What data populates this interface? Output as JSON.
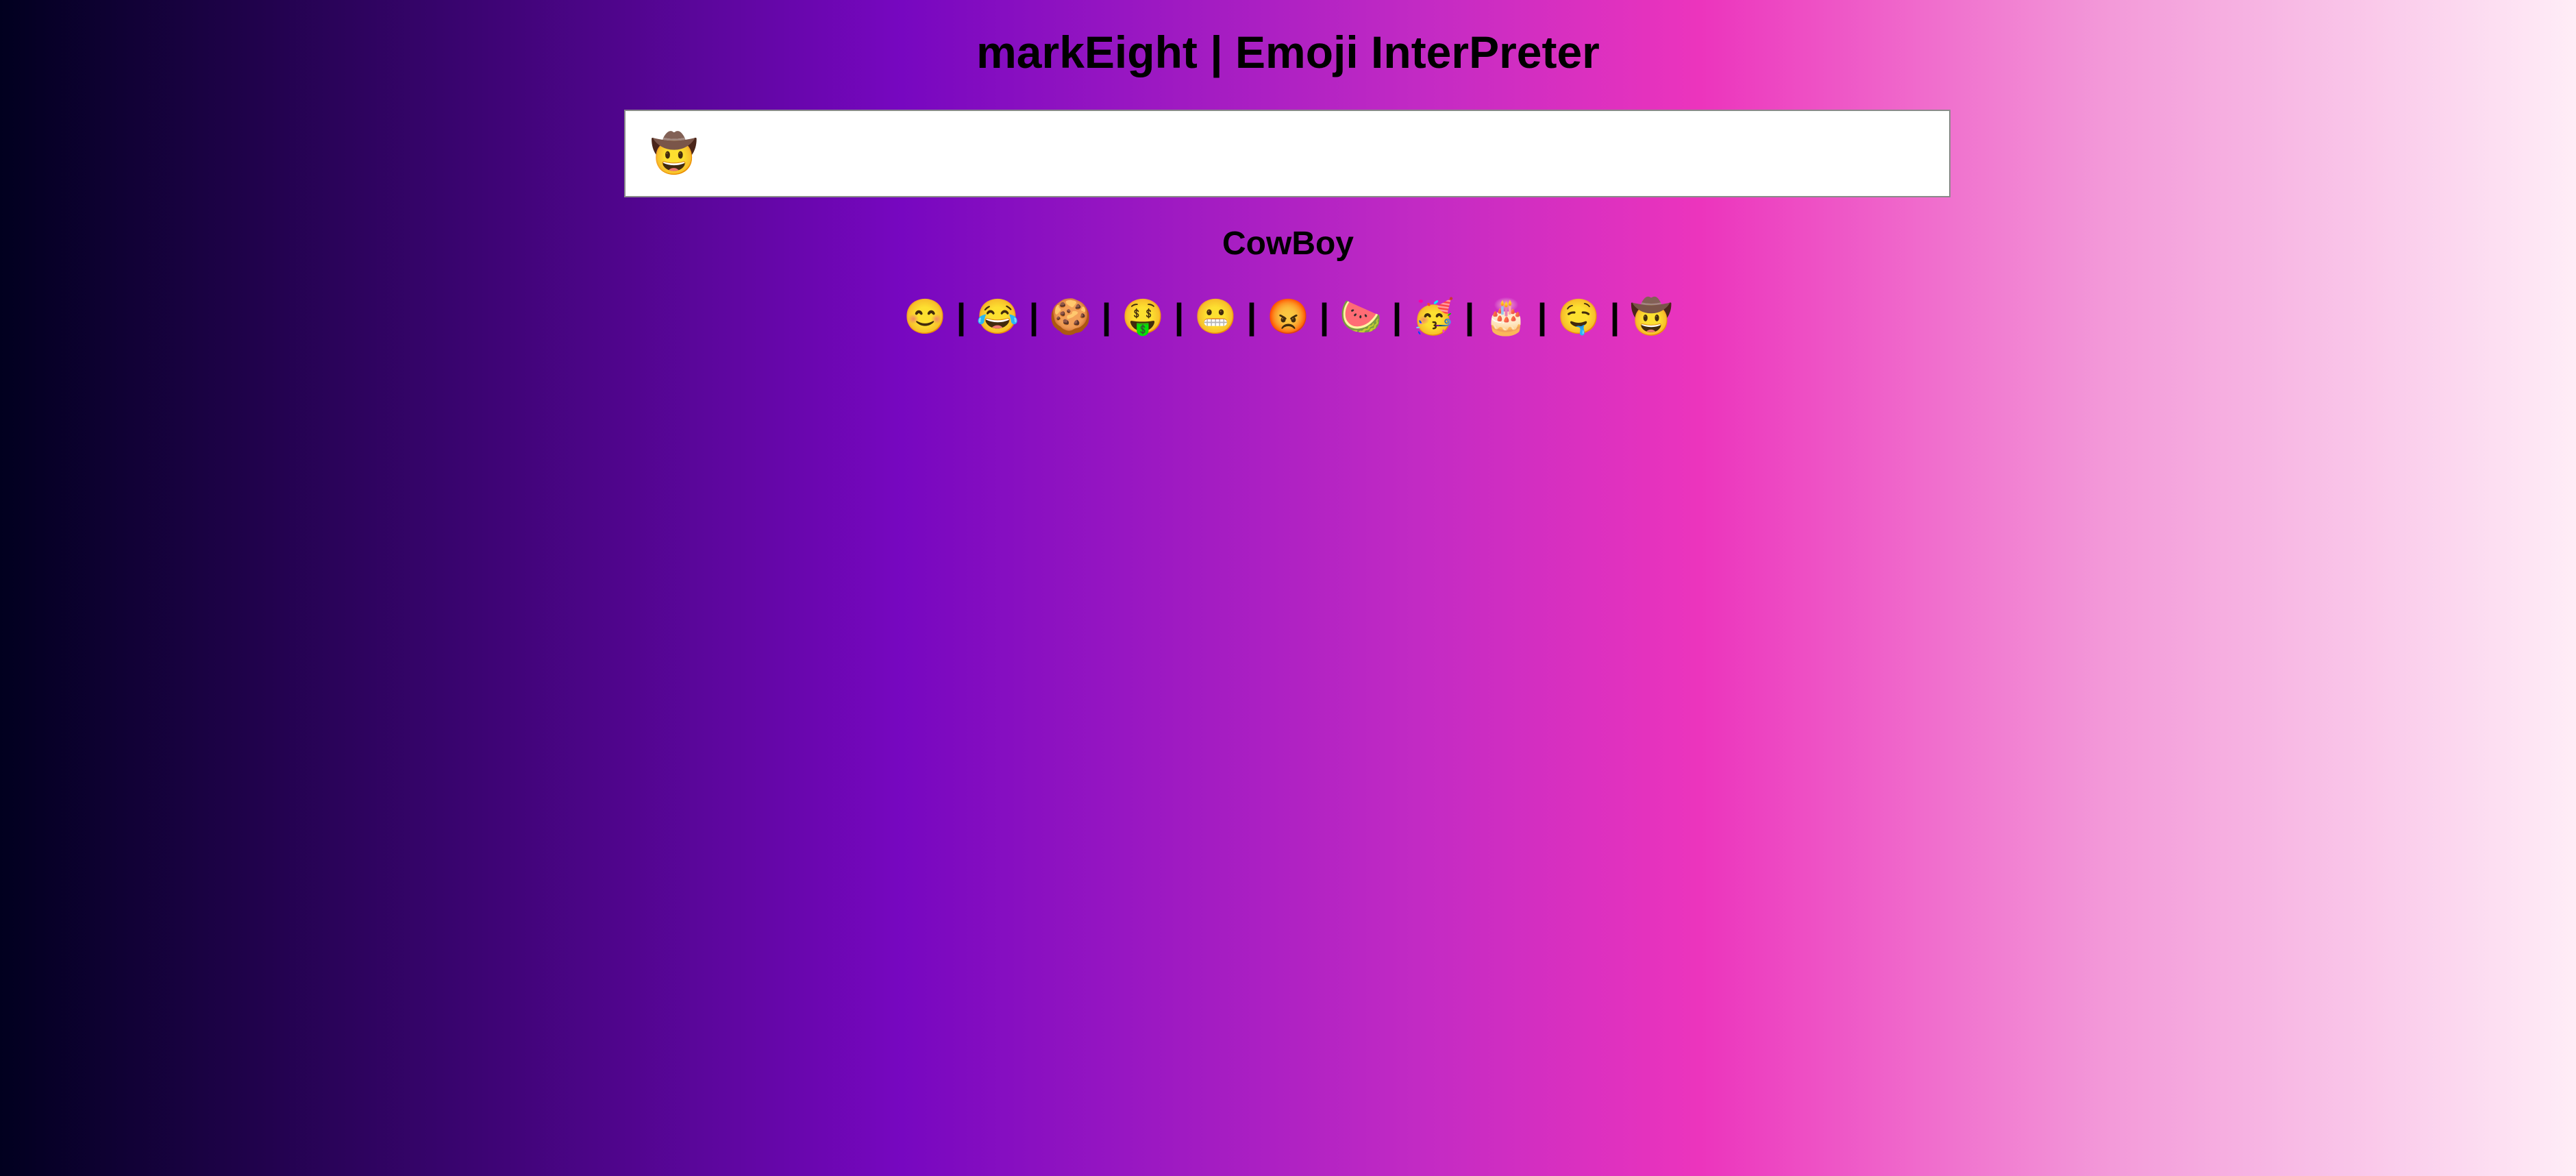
{
  "header": {
    "title": "markEight | Emoji InterPreter"
  },
  "search": {
    "value": "🤠",
    "placeholder": ""
  },
  "output": {
    "meaning": "CowBoy"
  },
  "emoji_list": {
    "separator": "|",
    "items": [
      {
        "emoji": "😊",
        "icon": "smiling-face-icon"
      },
      {
        "emoji": "😂",
        "icon": "tears-of-joy-icon"
      },
      {
        "emoji": "🍪",
        "icon": "cookie-icon"
      },
      {
        "emoji": "🤑",
        "icon": "money-mouth-icon"
      },
      {
        "emoji": "😬",
        "icon": "grimacing-face-icon"
      },
      {
        "emoji": "😡",
        "icon": "angry-face-icon"
      },
      {
        "emoji": "🍉",
        "icon": "watermelon-icon"
      },
      {
        "emoji": "🥳",
        "icon": "party-face-icon"
      },
      {
        "emoji": "🎂",
        "icon": "birthday-cake-icon"
      },
      {
        "emoji": "🤤",
        "icon": "drooling-face-icon"
      },
      {
        "emoji": "🤠",
        "icon": "cowboy-face-icon"
      }
    ]
  },
  "colors": {
    "gradient": [
      "#01001f",
      "#7707c0",
      "#ec34bd",
      "#ffedf7"
    ],
    "text": "#000000"
  }
}
